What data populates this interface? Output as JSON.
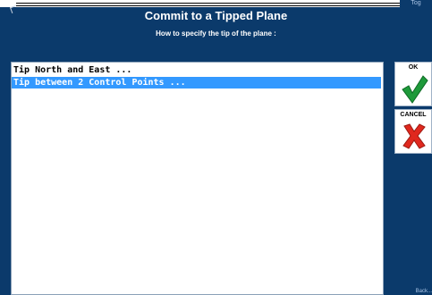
{
  "window": {
    "title": "Commit to a Tipped Plane",
    "subtitle": "How to specify the tip of the plane :",
    "corner_logo": "Tog"
  },
  "list": {
    "items": [
      {
        "label": "Tip North and East ...",
        "selected": false
      },
      {
        "label": "Tip between 2 Control Points ...",
        "selected": true
      }
    ]
  },
  "buttons": {
    "ok_label": "OK",
    "cancel_label": "CANCEL"
  },
  "colors": {
    "background": "#0b3a6b",
    "selection": "#3399ff",
    "ok_check": "#1e9a3a",
    "cancel_x": "#e0281e"
  },
  "footer": {
    "bottom_right": "Back..."
  }
}
